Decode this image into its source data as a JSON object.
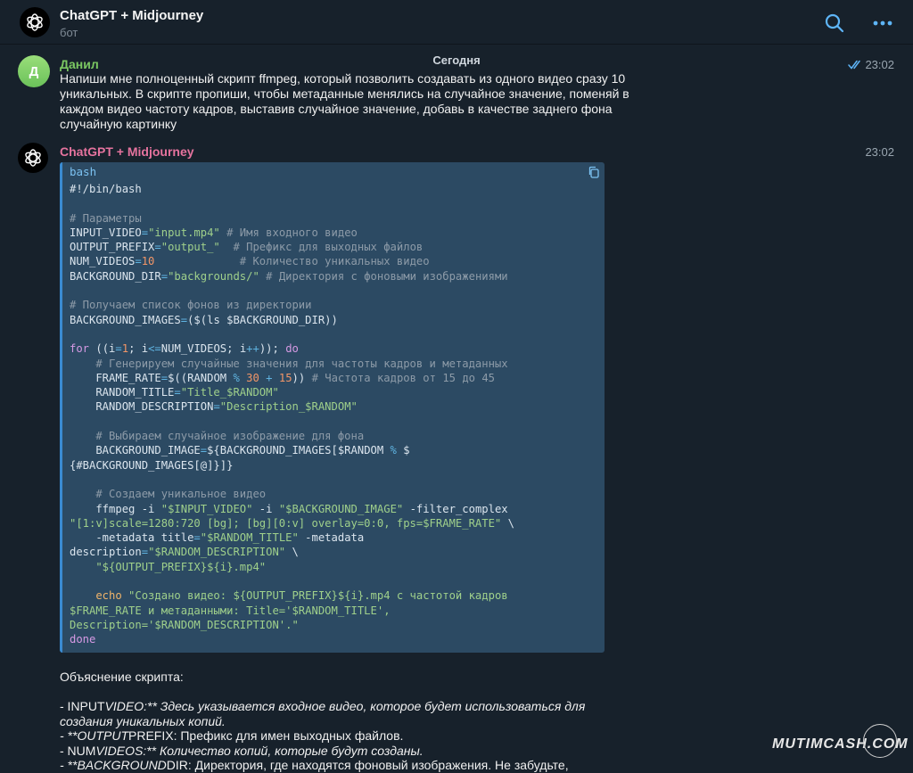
{
  "header": {
    "title": "ChatGPT + Midjourney",
    "subtitle": "бот",
    "icons": [
      "openai-logo-icon",
      "search-icon",
      "more-dots-icon"
    ]
  },
  "date_separator": "Сегодня",
  "user_message": {
    "avatar_letter": "Д",
    "sender": "Данил",
    "time": "23:02",
    "lines": [
      "Напиши мне полноценный скрипт ffmpeg, который позволить создавать из одного видео сразу 10",
      "уникальных. В скрипте пропиши, чтобы метаданные менялись на случайное значение, поменяй в",
      "каждом видео частоту кадров, выставив случайное значение, добавь в качестве заднего фона",
      "случайную картинку"
    ]
  },
  "bot_message": {
    "sender": "ChatGPT + Midjourney",
    "time": "23:02",
    "code_language": "bash",
    "code_lines": [
      [
        {
          "t": "#!/bin/bash",
          "k": "ident"
        }
      ],
      [],
      [
        {
          "t": "# Параметры",
          "k": "comment"
        }
      ],
      [
        {
          "t": "INPUT_VIDEO",
          "k": "ident"
        },
        {
          "t": "=",
          "k": "op"
        },
        {
          "t": "\"input.mp4\"",
          "k": "string"
        },
        {
          "t": " # Имя входного видео",
          "k": "comment"
        }
      ],
      [
        {
          "t": "OUTPUT_PREFIX",
          "k": "ident"
        },
        {
          "t": "=",
          "k": "op"
        },
        {
          "t": "\"output_\"",
          "k": "string"
        },
        {
          "t": "  # Префикс для выходных файлов",
          "k": "comment"
        }
      ],
      [
        {
          "t": "NUM_VIDEOS",
          "k": "ident"
        },
        {
          "t": "=",
          "k": "op"
        },
        {
          "t": "10",
          "k": "number"
        },
        {
          "t": "             # Количество уникальных видео",
          "k": "comment"
        }
      ],
      [
        {
          "t": "BACKGROUND_DIR",
          "k": "ident"
        },
        {
          "t": "=",
          "k": "op"
        },
        {
          "t": "\"backgrounds/\"",
          "k": "string"
        },
        {
          "t": " # Директория с фоновыми изображениями",
          "k": "comment"
        }
      ],
      [],
      [
        {
          "t": "# Получаем список фонов из директории",
          "k": "comment"
        }
      ],
      [
        {
          "t": "BACKGROUND_IMAGES",
          "k": "ident"
        },
        {
          "t": "=",
          "k": "op"
        },
        {
          "t": "($(ls $BACKGROUND_DIR))",
          "k": "ident"
        }
      ],
      [],
      [
        {
          "t": "for",
          "k": "keyword"
        },
        {
          "t": " ((i",
          "k": "ident"
        },
        {
          "t": "=",
          "k": "op"
        },
        {
          "t": "1",
          "k": "number"
        },
        {
          "t": "; i",
          "k": "ident"
        },
        {
          "t": "<=",
          "k": "op"
        },
        {
          "t": "NUM_VIDEOS; i",
          "k": "ident"
        },
        {
          "t": "++",
          "k": "op"
        },
        {
          "t": ")); ",
          "k": "ident"
        },
        {
          "t": "do",
          "k": "keyword"
        }
      ],
      [
        {
          "t": "    # Генерируем случайные значения для частоты кадров и метаданных",
          "k": "comment"
        }
      ],
      [
        {
          "t": "    FRAME_RATE",
          "k": "ident"
        },
        {
          "t": "=",
          "k": "op"
        },
        {
          "t": "$((RANDOM ",
          "k": "ident"
        },
        {
          "t": "%",
          "k": "op"
        },
        {
          "t": " ",
          "k": "ident"
        },
        {
          "t": "30",
          "k": "number"
        },
        {
          "t": " ",
          "k": "ident"
        },
        {
          "t": "+",
          "k": "op"
        },
        {
          "t": " ",
          "k": "ident"
        },
        {
          "t": "15",
          "k": "number"
        },
        {
          "t": "))",
          "k": "ident"
        },
        {
          "t": " # Частота кадров от 15 до 45",
          "k": "comment"
        }
      ],
      [
        {
          "t": "    RANDOM_TITLE",
          "k": "ident"
        },
        {
          "t": "=",
          "k": "op"
        },
        {
          "t": "\"Title_$RANDOM\"",
          "k": "string"
        }
      ],
      [
        {
          "t": "    RANDOM_DESCRIPTION",
          "k": "ident"
        },
        {
          "t": "=",
          "k": "op"
        },
        {
          "t": "\"Description_$RANDOM\"",
          "k": "string"
        }
      ],
      [],
      [
        {
          "t": "    # Выбираем случайное изображение для фона",
          "k": "comment"
        }
      ],
      [
        {
          "t": "    BACKGROUND_IMAGE",
          "k": "ident"
        },
        {
          "t": "=",
          "k": "op"
        },
        {
          "t": "${BACKGROUND_IMAGES[$RANDOM ",
          "k": "ident"
        },
        {
          "t": "%",
          "k": "op"
        },
        {
          "t": " $",
          "k": "ident"
        }
      ],
      [
        {
          "t": "{#BACKGROUND_IMAGES[@]}]}",
          "k": "ident"
        }
      ],
      [],
      [
        {
          "t": "    # Создаем уникальное видео",
          "k": "comment"
        }
      ],
      [
        {
          "t": "    ffmpeg -i ",
          "k": "ident"
        },
        {
          "t": "\"$INPUT_VIDEO\"",
          "k": "string"
        },
        {
          "t": " -i ",
          "k": "ident"
        },
        {
          "t": "\"$BACKGROUND_IMAGE\"",
          "k": "string"
        },
        {
          "t": " -filter_complex",
          "k": "ident"
        }
      ],
      [
        {
          "t": "\"[1:v]scale=1280:720 [bg]; [bg][0:v] overlay=0:0, fps=$FRAME_RATE\"",
          "k": "string"
        },
        {
          "t": " \\",
          "k": "ident"
        }
      ],
      [
        {
          "t": "    -metadata title",
          "k": "ident"
        },
        {
          "t": "=",
          "k": "op"
        },
        {
          "t": "\"$RANDOM_TITLE\"",
          "k": "string"
        },
        {
          "t": " -metadata",
          "k": "ident"
        }
      ],
      [
        {
          "t": "description",
          "k": "ident"
        },
        {
          "t": "=",
          "k": "op"
        },
        {
          "t": "\"$RANDOM_DESCRIPTION\"",
          "k": "string"
        },
        {
          "t": " \\",
          "k": "ident"
        }
      ],
      [
        {
          "t": "    \"${OUTPUT_PREFIX}${i}.mp4\"",
          "k": "string"
        }
      ],
      [],
      [
        {
          "t": "    echo",
          "k": "echo"
        },
        {
          "t": " \"Создано видео: ${OUTPUT_PREFIX}${i}.mp4 с частотой кадров",
          "k": "string"
        }
      ],
      [
        {
          "t": "$FRAME_RATE и метаданными: Title='$RANDOM_TITLE',",
          "k": "string"
        }
      ],
      [
        {
          "t": "Description='$RANDOM_DESCRIPTION'.\"",
          "k": "string"
        }
      ],
      [
        {
          "t": "done",
          "k": "keyword"
        }
      ]
    ],
    "explanation": [
      [
        {
          "t": "Объяснение скрипта:",
          "i": false
        }
      ],
      [],
      [
        {
          "t": "- INPUT",
          "i": false
        },
        {
          "t": "VIDEO:** Здесь указывается входное видео, которое будет использоваться для",
          "i": true
        }
      ],
      [
        {
          "t": "создания уникальных копий.",
          "i": true
        }
      ],
      [
        {
          "t": "- **OUTPUT",
          "i": true
        },
        {
          "t": "PREFIX: Префикс для имен выходных файлов.",
          "i": false
        }
      ],
      [
        {
          "t": "- NUM",
          "i": false
        },
        {
          "t": "VIDEOS:** Количество копий, которые будут созданы.",
          "i": true
        }
      ],
      [
        {
          "t": "- **BACKGROUND",
          "i": true
        },
        {
          "t": "DIR: Директория, где находятся фоновый изображения. Не забудьте,",
          "i": false
        }
      ]
    ]
  },
  "watermark": "MUTIMCASH.COM"
}
